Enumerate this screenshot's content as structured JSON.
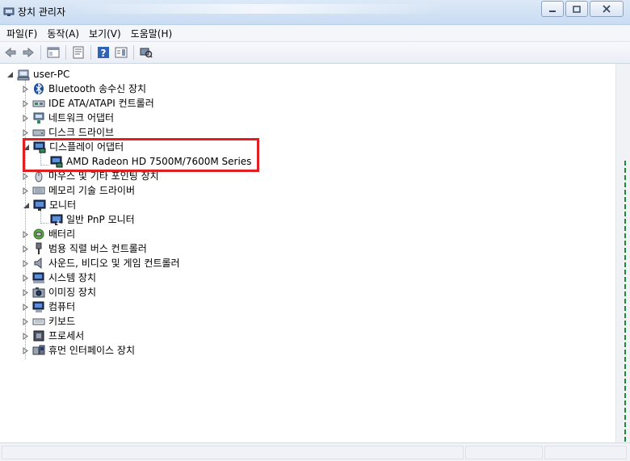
{
  "window": {
    "title": "장치 관리자"
  },
  "menu": {
    "items": [
      "파일(F)",
      "동작(A)",
      "보기(V)",
      "도움말(H)"
    ]
  },
  "toolbar": {
    "icons": [
      "back-arrow-icon",
      "forward-arrow-icon",
      "show-hide-tree-icon",
      "properties-icon",
      "help-icon",
      "action-pane-icon",
      "scan-hardware-icon"
    ]
  },
  "tree": {
    "root": "user-PC",
    "nodes": [
      {
        "label": "Bluetooth 송수신 장치",
        "icon": "bluetooth-icon",
        "expanded": false
      },
      {
        "label": "IDE ATA/ATAPI 컨트롤러",
        "icon": "ide-controller-icon",
        "expanded": false
      },
      {
        "label": "네트워크 어댑터",
        "icon": "network-adapter-icon",
        "expanded": false
      },
      {
        "label": "디스크 드라이브",
        "icon": "disk-drive-icon",
        "expanded": false
      },
      {
        "label": "디스플레이 어댑터",
        "icon": "display-adapter-icon",
        "expanded": true,
        "children": [
          {
            "label": "AMD Radeon HD 7500M/7600M Series",
            "icon": "display-adapter-icon"
          }
        ]
      },
      {
        "label": "마우스 및 기타 포인팅 장치",
        "icon": "mouse-icon",
        "expanded": false
      },
      {
        "label": "메모리 기술 드라이버",
        "icon": "memory-icon",
        "expanded": false
      },
      {
        "label": "모니터",
        "icon": "monitor-icon",
        "expanded": true,
        "children": [
          {
            "label": "일반 PnP 모니터",
            "icon": "monitor-icon"
          }
        ]
      },
      {
        "label": "배터리",
        "icon": "battery-icon",
        "expanded": false
      },
      {
        "label": "범용 직렬 버스 컨트롤러",
        "icon": "usb-icon",
        "expanded": false
      },
      {
        "label": "사운드, 비디오 및 게임 컨트롤러",
        "icon": "speaker-icon",
        "expanded": false
      },
      {
        "label": "시스템 장치",
        "icon": "system-device-icon",
        "expanded": false
      },
      {
        "label": "이미징 장치",
        "icon": "camera-icon",
        "expanded": false
      },
      {
        "label": "컴퓨터",
        "icon": "computer-icon",
        "expanded": false
      },
      {
        "label": "키보드",
        "icon": "keyboard-icon",
        "expanded": false
      },
      {
        "label": "프로세서",
        "icon": "processor-icon",
        "expanded": false
      },
      {
        "label": "휴먼 인터페이스 장치",
        "icon": "hid-icon",
        "expanded": false
      }
    ]
  },
  "annotation": {
    "color": "#e02020"
  }
}
